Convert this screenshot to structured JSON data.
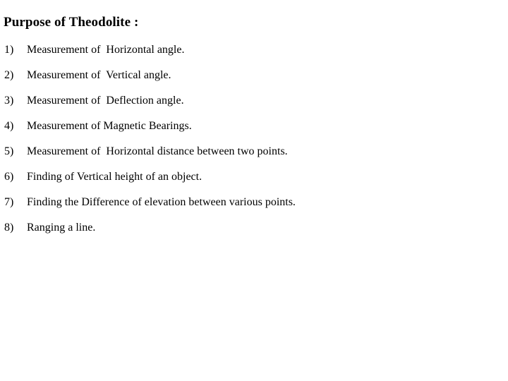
{
  "slide": {
    "title": "Purpose of Theodolite :",
    "background_color": "#ffffff",
    "text_color": "#000000",
    "items": [
      {
        "number": "1)",
        "text": "Measurement of  Horizontal angle."
      },
      {
        "number": "2)",
        "text": "Measurement of  Vertical angle."
      },
      {
        "number": "3)",
        "text": "Measurement of  Deflection angle."
      },
      {
        "number": "4)",
        "text": "Measurement of Magnetic Bearings."
      },
      {
        "number": "5)",
        "text": "Measurement of  Horizontal distance between two points."
      },
      {
        "number": "6)",
        "text": "Finding of Vertical height of an object."
      },
      {
        "number": "7)",
        "text": "Finding the Difference of elevation between various points."
      },
      {
        "number": "8)",
        "text": "Ranging a line."
      }
    ]
  }
}
